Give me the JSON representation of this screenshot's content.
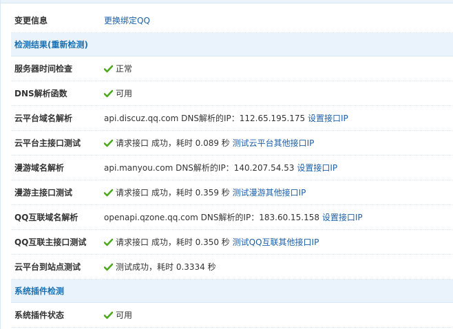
{
  "rows": {
    "change_info": {
      "label": "变更信息",
      "link": "更换绑定QQ"
    },
    "section_check": {
      "title": "检测结果(重新检测)"
    },
    "server_time": {
      "label": "服务器时间检查",
      "value": "正常"
    },
    "dns_func": {
      "label": "DNS解析函数",
      "value": "可用"
    },
    "cloud_domain": {
      "label": "云平台域名解析",
      "value": "api.discuz.qq.com DNS解析的IP：112.65.195.175",
      "link": "设置接口IP"
    },
    "cloud_main": {
      "label": "云平台主接口测试",
      "value": "请求接口 成功，耗时 0.089 秒",
      "link": "测试云平台其他接口IP"
    },
    "manyou_domain": {
      "label": "漫游域名解析",
      "value": "api.manyou.com DNS解析的IP：140.207.54.53",
      "link": "设置接口IP"
    },
    "manyou_main": {
      "label": "漫游主接口测试",
      "value": "请求接口 成功，耗时 0.359 秒",
      "link": "测试漫游其他接口IP"
    },
    "qq_domain": {
      "label": "QQ互联域名解析",
      "value": "openapi.qzone.qq.com DNS解析的IP：183.60.15.158",
      "link": "设置接口IP"
    },
    "qq_main": {
      "label": "QQ互联主接口测试",
      "value": "请求接口 成功，耗时 0.350 秒",
      "link": "测试QQ互联其他接口IP"
    },
    "cloud_site": {
      "label": "云平台到站点测试",
      "value": "测试成功，耗时 0.3334 秒"
    },
    "section_plugin": {
      "title": "系统插件检测"
    },
    "plugin_status": {
      "label": "系统插件状态",
      "value": "可用"
    }
  },
  "colors": {
    "success_check": "#4caa1c",
    "link": "#1b5fa8",
    "section_title": "#1a72b4",
    "section_bg": "#eaf3fb"
  },
  "icons": {
    "success": "check-icon"
  }
}
